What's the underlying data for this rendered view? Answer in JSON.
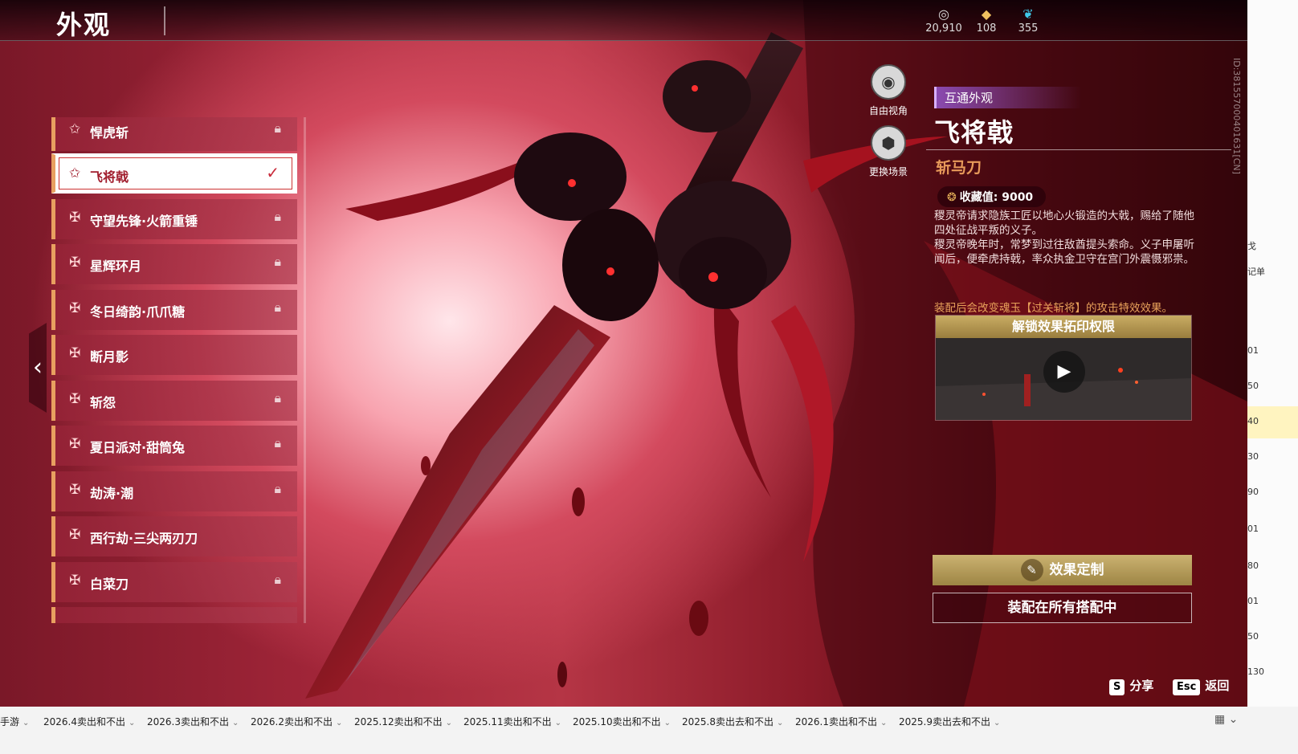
{
  "header": {
    "title": "外观",
    "currencies": [
      {
        "icon": "spirit-currency-icon",
        "value": "20,910"
      },
      {
        "icon": "gold-ingot-icon",
        "value": "108"
      },
      {
        "icon": "feather-icon",
        "value": "355"
      }
    ]
  },
  "skins": [
    {
      "name": "悍虎斩",
      "locked": true,
      "selected": false
    },
    {
      "name": "飞将戟",
      "locked": false,
      "selected": true
    },
    {
      "name": "守望先锋·火箭重锤",
      "locked": true,
      "selected": false
    },
    {
      "name": "星辉环月",
      "locked": true,
      "selected": false
    },
    {
      "name": "冬日绮韵·爪爪糖",
      "locked": true,
      "selected": false
    },
    {
      "name": "断月影",
      "locked": false,
      "selected": false
    },
    {
      "name": "斩怨",
      "locked": true,
      "selected": false
    },
    {
      "name": "夏日派对·甜筒兔",
      "locked": true,
      "selected": false
    },
    {
      "name": "劫涛·潮",
      "locked": true,
      "selected": false
    },
    {
      "name": "西行劫·三尖两刃刀",
      "locked": false,
      "selected": false
    },
    {
      "name": "白菜刀",
      "locked": true,
      "selected": false
    }
  ],
  "view_controls": {
    "free_view": "自由视角",
    "change_scene": "更换场景"
  },
  "detail": {
    "badge": "互通外观",
    "name": "飞将戟",
    "type": "斩马刀",
    "collect_label": "收藏值: 9000",
    "desc_1": "稷灵帝请求隐族工匠以地心火锻造的大戟，赐给了随他四处征战平叛的义子。",
    "desc_2": "稷灵帝晚年时，常梦到过往敌酋提头索命。义子申屠听闻后，便牵虎持戟，率众执金卫守在宫门外震慑邪祟。",
    "effect_note": "装配后会改变魂玉【过关斩将】的攻击特效效果。",
    "unlock_title": "解锁效果拓印权限",
    "custom_button": "效果定制",
    "equip_button": "装配在所有搭配中"
  },
  "hotkeys": [
    {
      "key": "S",
      "label": "分享"
    },
    {
      "key": "Esc",
      "label": "返回"
    }
  ],
  "uid": "ID:381557000401631[CN]",
  "side_fragments": [
    "戈",
    "记单",
    "01",
    "50",
    "40",
    "30",
    "90",
    "01",
    "80",
    "01",
    "50",
    "130"
  ],
  "sheet_tabs": [
    "手游",
    "2026.4卖出和不出",
    "2026.3卖出和不出",
    "2026.2卖出和不出",
    "2025.12卖出和不出",
    "2025.11卖出和不出",
    "2025.10卖出和不出",
    "2025.8卖出去和不出",
    "2026.1卖出和不出",
    "2025.9卖出去和不出"
  ]
}
